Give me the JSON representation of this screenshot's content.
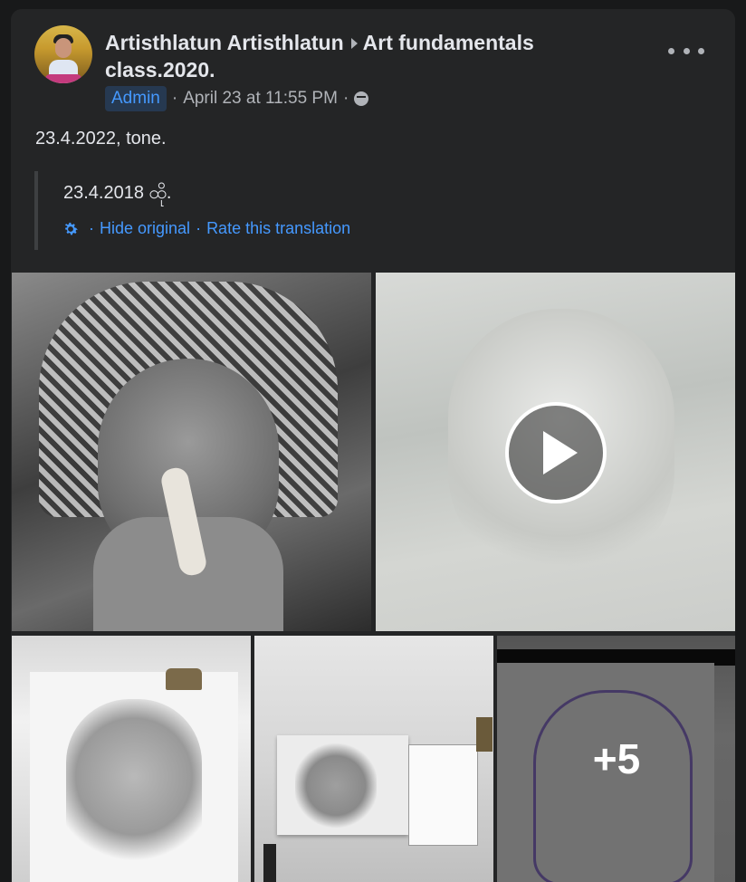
{
  "post": {
    "author": "Artisthlatun Artisthlatun",
    "group": "Art fundamentals class.2020.",
    "badge": "Admin",
    "timestamp": "April 23 at 11:55 PM",
    "separator": "·",
    "text": "23.4.2022, tone.",
    "translated_text": "23.4.2018 ထို.",
    "hide_original": "Hide original",
    "rate_translation": "Rate this translation",
    "more_count": "+5"
  },
  "icons": {
    "more": "more-options-icon",
    "privacy": "group-members-icon",
    "settings": "gear-icon",
    "play": "play-icon"
  },
  "colors": {
    "background": "#18191a",
    "card": "#242526",
    "primary_text": "#e4e6eb",
    "secondary_text": "#b0b3b8",
    "link": "#4599ff",
    "badge_bg": "#263951"
  }
}
